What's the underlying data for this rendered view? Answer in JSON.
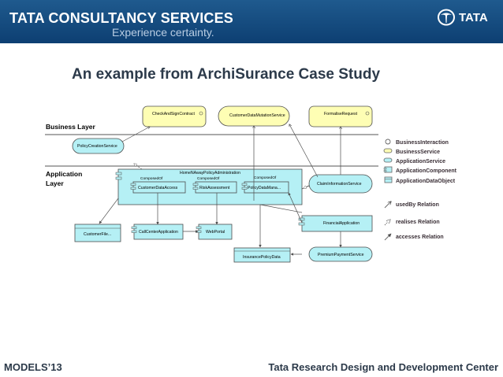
{
  "header": {
    "company": "TATA CONSULTANCY SERVICES",
    "tagline": "Experience certainty.",
    "brand": "TATA"
  },
  "slide": {
    "title": "An example from ArchiSurance Case Study"
  },
  "diagram": {
    "business_layer_label": "Business Layer",
    "application_layer_label_1": "Application",
    "application_layer_label_2": "Layer",
    "business_services": [
      "CheckAndSignContract",
      "CustomerDataMutationService",
      "FormaliseRequest"
    ],
    "application_services": [
      "PolicyCreationService",
      "ClaimInformationService",
      "PremiumPaymentService"
    ],
    "container": "HomeNAwayPolicyAdministration",
    "composed_of": [
      "ComposedOf",
      "ComposedOf",
      "ComposedOf"
    ],
    "components_inner": [
      "CustomerDataAccess",
      "RiskAssessment",
      "PolicyDataMana..."
    ],
    "components_other": [
      "FinancialApplication",
      "CallCenterApplication",
      "WebPortal"
    ],
    "data_objects": [
      "CustomerFile...",
      "InsurancePolicyData"
    ],
    "legend": [
      {
        "label": "BusinessInteraction",
        "icon": "business-interaction-icon"
      },
      {
        "label": "BusinessService",
        "icon": "business-service-icon"
      },
      {
        "label": "ApplicationService",
        "icon": "application-service-icon"
      },
      {
        "label": "ApplicationComponent",
        "icon": "application-component-icon"
      },
      {
        "label": "ApplicationDataObject",
        "icon": "application-data-object-icon"
      },
      {
        "label": "usedBy Relation",
        "icon": "usedby-arrow-icon"
      },
      {
        "label": "realises Relation",
        "icon": "realises-arrow-icon"
      },
      {
        "label": "accesses Relation",
        "icon": "accesses-arrow-icon"
      }
    ],
    "colors": {
      "business": "#fefeb4",
      "application": "#b5f0f5",
      "stroke": "#4d4d4d"
    }
  },
  "footer": {
    "left": "MODELS’13",
    "right": "Tata Research Design and Development Center"
  }
}
